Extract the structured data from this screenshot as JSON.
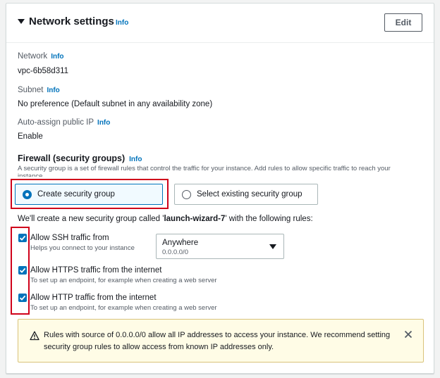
{
  "header": {
    "title": "Network settings",
    "info": "Info",
    "edit_label": "Edit"
  },
  "fields": [
    {
      "label": "Network",
      "info": "Info",
      "value": "vpc-6b58d311"
    },
    {
      "label": "Subnet",
      "info": "Info",
      "value": "No preference (Default subnet in any availability zone)"
    },
    {
      "label": "Auto-assign public IP",
      "info": "Info",
      "value": "Enable"
    }
  ],
  "firewall": {
    "title": "Firewall (security groups)",
    "info": "Info",
    "description": "A security group is a set of firewall rules that control the traffic for your instance. Add rules to allow specific traffic to reach your",
    "description_cont": "instance.",
    "options": [
      {
        "label": "Create security group",
        "selected": true
      },
      {
        "label": "Select existing security group",
        "selected": false
      }
    ],
    "intro_prefix": "We'll create a new security group called '",
    "group_name": "launch-wizard-7",
    "intro_suffix": "' with the following rules:"
  },
  "rules": [
    {
      "label": "Allow SSH traffic from",
      "hint": "Helps you connect to your instance",
      "checked": true
    },
    {
      "label": "Allow HTTPS traffic from the internet",
      "hint": "To set up an endpoint, for example when creating a web server",
      "checked": true
    },
    {
      "label": "Allow HTTP traffic from the internet",
      "hint": "To set up an endpoint, for example when creating a web server",
      "checked": true
    }
  ],
  "ssh_source": {
    "value": "Anywhere",
    "sub": "0.0.0.0/0"
  },
  "alert": {
    "text": "Rules with source of 0.0.0.0/0 allow all IP addresses to access your instance. We recommend setting security group rules to allow access from known IP addresses only.",
    "icon": "warning-icon"
  },
  "colors": {
    "accent": "#0073bb",
    "highlight": "#d0021b",
    "warning": "#d9c37a"
  }
}
